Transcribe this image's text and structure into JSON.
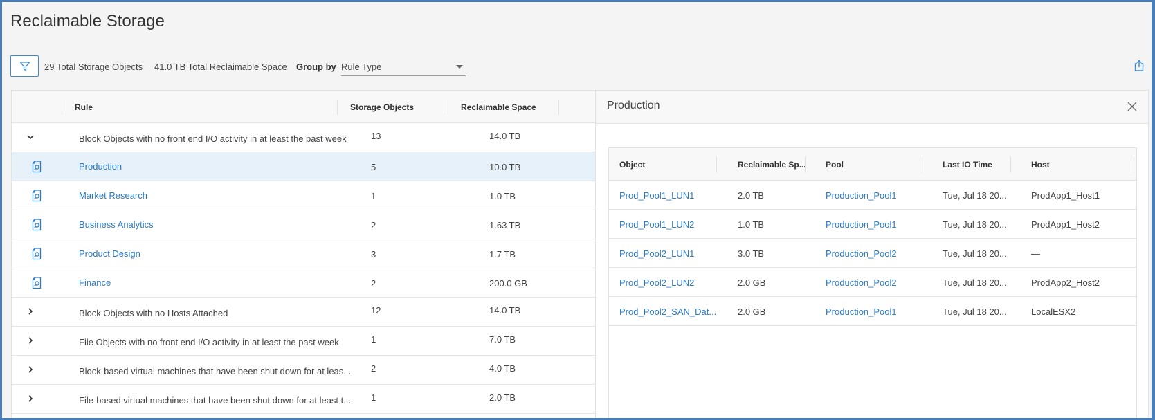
{
  "page": {
    "title": "Reclaimable Storage"
  },
  "toolbar": {
    "filter_icon": "filter-icon",
    "total_objects": "29 Total Storage Objects",
    "total_space": "41.0 TB Total Reclaimable Space",
    "group_by_label": "Group by",
    "group_by_value": "Rule Type",
    "export_icon": "export-icon"
  },
  "rules_table": {
    "columns": [
      "",
      "Rule",
      "Storage Objects",
      "Reclaimable Space"
    ],
    "rows": [
      {
        "type": "group",
        "expanded": true,
        "name": "Block Objects with no front end I/O activity in at least the past week",
        "count": "13",
        "space": "14.0 TB"
      },
      {
        "type": "child",
        "selected": true,
        "name": "Production",
        "count": "5",
        "space": "10.0 TB"
      },
      {
        "type": "child",
        "name": "Market Research",
        "count": "1",
        "space": "1.0 TB"
      },
      {
        "type": "child",
        "name": "Business Analytics",
        "count": "2",
        "space": "1.63 TB"
      },
      {
        "type": "child",
        "name": "Product Design",
        "count": "3",
        "space": "1.7 TB"
      },
      {
        "type": "child",
        "name": "Finance",
        "count": "2",
        "space": "200.0 GB"
      },
      {
        "type": "group",
        "expanded": false,
        "name": "Block Objects with no Hosts Attached",
        "count": "12",
        "space": "14.0 TB"
      },
      {
        "type": "group",
        "expanded": false,
        "name": "File Objects with no front end I/O activity in at least the past week",
        "count": "1",
        "space": "7.0 TB"
      },
      {
        "type": "group",
        "expanded": false,
        "name": "Block-based virtual machines that have been shut down for at leas...",
        "count": "2",
        "space": "4.0 TB"
      },
      {
        "type": "group",
        "expanded": false,
        "name": "File-based virtual machines that have been shut down for at least t...",
        "count": "1",
        "space": "2.0 TB"
      }
    ]
  },
  "detail_panel": {
    "title": "Production",
    "close_icon": "close-icon",
    "columns": [
      "Object",
      "Reclaimable Sp...",
      "Pool",
      "Last IO Time",
      "Host"
    ],
    "rows": [
      {
        "object": "Prod_Pool1_LUN1",
        "space": "2.0 TB",
        "pool": "Production_Pool1",
        "last_io": "Tue, Jul 18 20...",
        "host": "ProdApp1_Host1"
      },
      {
        "object": "Prod_Pool1_LUN2",
        "space": "1.0 TB",
        "pool": "Production_Pool1",
        "last_io": "Tue, Jul 18 20...",
        "host": "ProdApp1_Host2"
      },
      {
        "object": "Prod_Pool2_LUN1",
        "space": "3.0 TB",
        "pool": "Production_Pool2",
        "last_io": "Tue, Jul 18 20...",
        "host": "—"
      },
      {
        "object": "Prod_Pool2_LUN2",
        "space": "2.0 GB",
        "pool": "Production_Pool2",
        "last_io": "Tue, Jul 18 20...",
        "host": "ProdApp2_Host2"
      },
      {
        "object": "Prod_Pool2_SAN_Dat...",
        "space": "2.0 GB",
        "pool": "Production_Pool1",
        "last_io": "Tue, Jul 18 20...",
        "host": "LocalESX2"
      }
    ]
  },
  "colors": {
    "accent": "#2a7bc4",
    "selected_row": "#e7f1fa",
    "frame_border": "#4a7ebb"
  }
}
